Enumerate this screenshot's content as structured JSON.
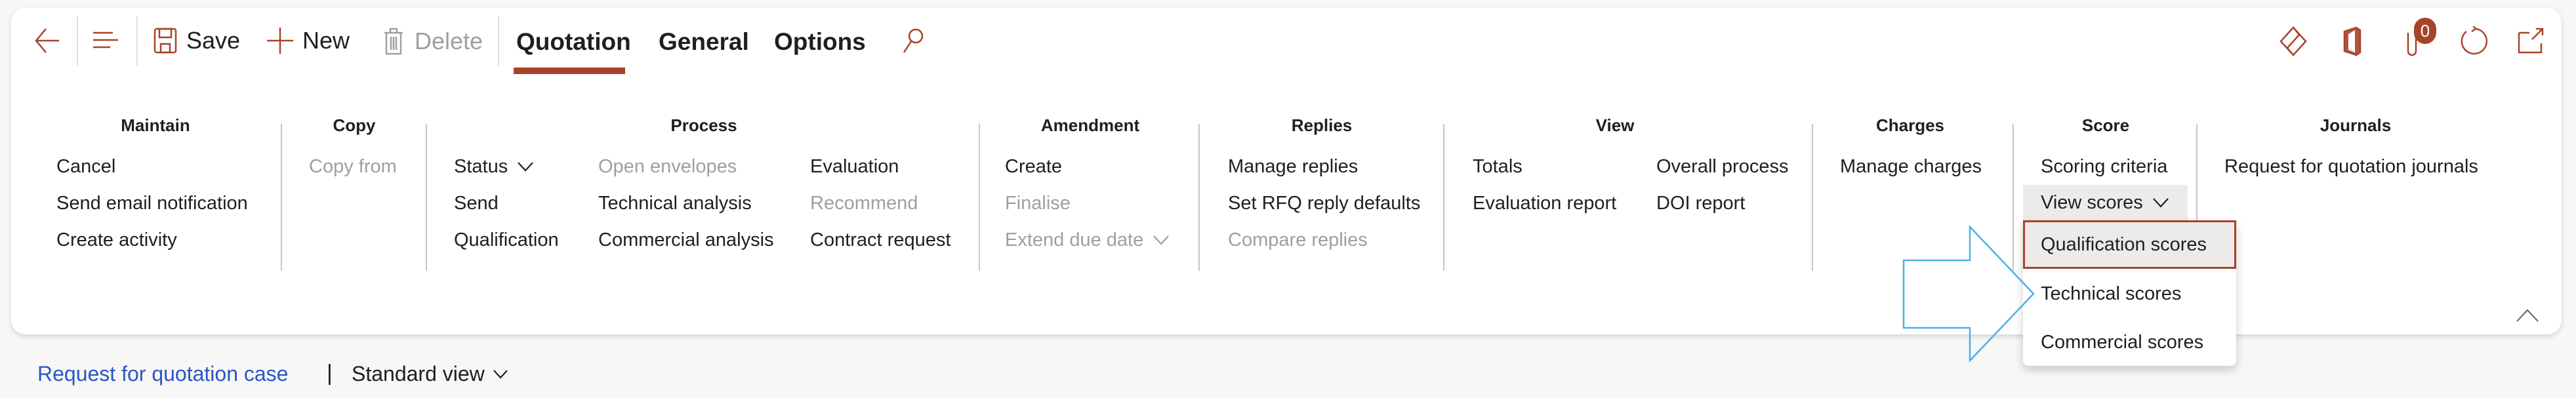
{
  "colors": {
    "accent": "#a8432a",
    "link": "#2b55c8",
    "disabled": "#a19f9d",
    "arrow": "#4ab0e8",
    "badge": "#a8432a"
  },
  "toolbar": {
    "back_icon": "back-arrow-icon",
    "menu_icon": "hamburger-icon",
    "save_label": "Save",
    "new_label": "New",
    "delete_label": "Delete",
    "tabs": [
      {
        "label": "Quotation",
        "active": true
      },
      {
        "label": "General"
      },
      {
        "label": "Options"
      }
    ],
    "search_icon": "search-icon",
    "right_icons": [
      "power-apps-icon",
      "office-icon",
      "attachments-icon",
      "refresh-icon",
      "open-in-new-window-icon"
    ],
    "attachments_count": "0"
  },
  "groups": {
    "maintain": {
      "title": "Maintain",
      "items": [
        "Cancel",
        "Send email notification",
        "Create activity"
      ]
    },
    "copy": {
      "title": "Copy",
      "items": [
        "Copy from"
      ]
    },
    "process": {
      "title": "Process",
      "items": [
        "Status",
        "Send",
        "Qualification",
        "Open envelopes",
        "Technical analysis",
        "Commercial analysis",
        "Evaluation",
        "Recommend",
        "Contract request"
      ]
    },
    "amendment": {
      "title": "Amendment",
      "items": [
        "Create",
        "Finalise",
        "Extend due date"
      ]
    },
    "replies": {
      "title": "Replies",
      "items": [
        "Manage replies",
        "Set RFQ reply defaults",
        "Compare replies"
      ]
    },
    "view": {
      "title": "View",
      "items": [
        "Totals",
        "Evaluation report",
        "Overall process",
        "DOI report"
      ]
    },
    "charges": {
      "title": "Charges",
      "items": [
        "Manage charges"
      ]
    },
    "score": {
      "title": "Score",
      "items": [
        "Scoring criteria",
        "View scores"
      ]
    },
    "journals": {
      "title": "Journals",
      "items": [
        "Request for quotation journals"
      ]
    }
  },
  "view_scores_menu": {
    "items": [
      "Qualification scores",
      "Technical scores",
      "Commercial scores"
    ],
    "highlighted": "Qualification scores"
  },
  "footer": {
    "link": "Request for quotation case",
    "separator": "|",
    "view": "Standard view"
  }
}
